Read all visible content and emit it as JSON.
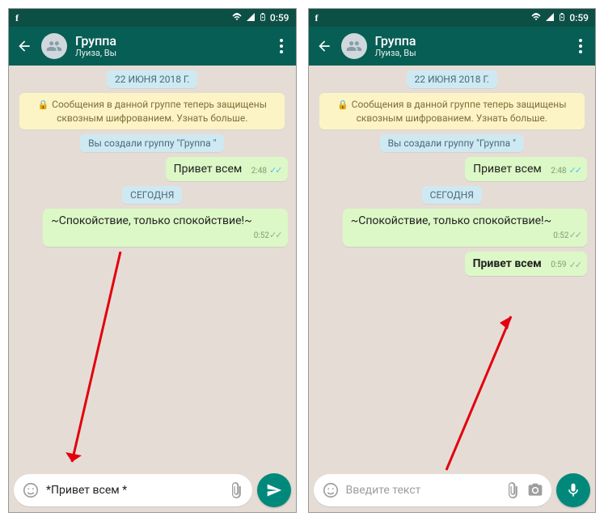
{
  "status": {
    "fb": "f",
    "time": "0:59"
  },
  "header": {
    "title": "Группа",
    "subtitle": "Луиза, Вы"
  },
  "chips": {
    "date": "22 ИЮНЯ 2018 Г.",
    "today": "СЕГОДНЯ",
    "created": "Вы создали группу \"Группа \""
  },
  "banner": "Сообщения в данной группе теперь защищены сквозным шифрованием. Узнать больше.",
  "messages": {
    "m1": {
      "text": "Привет всем",
      "time": "2:48"
    },
    "m2": {
      "text": "~Спокойствие, только спокойствие!~",
      "time": "0:52"
    },
    "m3": {
      "text": "Привет всем",
      "time": "0:59"
    }
  },
  "input": {
    "typed": "*Привет всем *",
    "placeholder": "Введите текст"
  }
}
